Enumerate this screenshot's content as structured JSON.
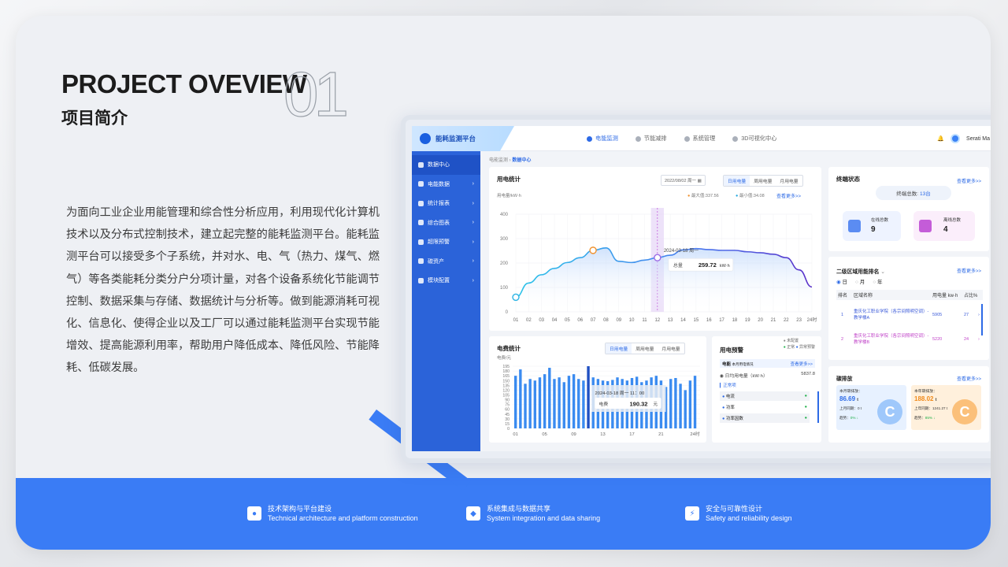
{
  "header": {
    "title_en": "PROJECT OVEVIEW",
    "title_num": "01",
    "title_cn": "项目简介"
  },
  "intro": "为面向工业企业用能管理和综合性分析应用，利用现代化计算机技术以及分布式控制技术，建立起完整的能耗监测平台。能耗监测平台可以接受多个子系统，并对水、电、气（热力、煤气、燃气）等各类能耗分类分户分项计量，对各个设备系统化节能调节控制、数据采集与存储、数据统计与分析等。做到能源消耗可视化、信息化、使得企业以及工厂可以通过能耗监测平台实现节能增效、提高能源利用率，帮助用户降低成本、降低风险、节能降耗、低碳发展。",
  "features": [
    {
      "cn": "技术架构与平台建设",
      "en": "Technical architecture and platform construction",
      "icon": "person-icon"
    },
    {
      "cn": "系统集成与数据共享",
      "en": "System integration and data sharing",
      "icon": "tag-icon"
    },
    {
      "cn": "安全与可靠性设计",
      "en": "Safety and reliability design",
      "icon": "bolt-icon"
    }
  ],
  "app": {
    "name": "能耗监测平台",
    "nav": [
      "电能监测",
      "节能减排",
      "系统管理",
      "3D可视化中心"
    ],
    "user": "Serati Ma",
    "sidebar": [
      "数据中心",
      "电能数据",
      "统计报表",
      "综合图表",
      "超限预警",
      "碳资产",
      "模块配置"
    ],
    "breadcrumb": {
      "parent": "电能监测",
      "current": "数据中心"
    },
    "usage": {
      "title": "用电统计",
      "date": "2022/08/02 周一",
      "tabs": [
        "日用电量",
        "周用电量",
        "月用电量"
      ],
      "unit": "用电量/kW·h",
      "max_label": "最大值:337.56",
      "min_label": "最小值:34.08",
      "more": "查看更多>>",
      "tooltip_time": "2024-03-18 周一",
      "tooltip_label": "总量",
      "tooltip_value": "259.72",
      "tooltip_unit": "kW·h"
    },
    "fee": {
      "title": "电费统计",
      "unit": "电费/元",
      "tabs": [
        "日用电量",
        "周用电量",
        "月用电量"
      ],
      "tooltip_time": "2024-03-18 周一 11：00",
      "tooltip_label": "电费",
      "tooltip_value": "190.32",
      "tooltip_unit": "元"
    },
    "warning": {
      "title": "用电预警",
      "legend": [
        "未配置",
        "正常",
        "异常预警"
      ],
      "sub_label": "电能",
      "sub_desc": "本月用电情况",
      "more": "查看更多>>",
      "daily_label": "日均用电量（kW·h）",
      "daily_value": "5837.8",
      "normal_label": "正常项",
      "items": [
        "电流",
        "功率",
        "功率因数"
      ]
    },
    "terminal": {
      "title": "终端状态",
      "more": "查看更多>>",
      "total_label": "终端总数:",
      "total_value": "13台",
      "online_label": "在线总数",
      "online_value": "9",
      "offline_label": "离线总数",
      "offline_value": "4"
    },
    "ranking": {
      "title": "二级区域用能排名",
      "more": "查看更多>>",
      "periods": [
        "日",
        "月",
        "年"
      ],
      "headers": [
        "排名",
        "区域名称",
        "用电量 kw·h",
        "占比%"
      ],
      "rows": [
        {
          "rank": "1",
          "name": "重庆化工职业学院（各宗间照明空调）-教学楼A",
          "value": "5905",
          "pct": "27"
        },
        {
          "rank": "2",
          "name": "重庆化工职业学院（各宗间照明空调）-教学楼B",
          "value": "5220",
          "pct": "24"
        }
      ]
    },
    "carbon": {
      "title": "碳排放",
      "more": "查看更多>>",
      "month_label": "本月碳排放：",
      "month_value": "86.69",
      "month_unit": "t",
      "month_prev": "上月同期：0 t",
      "month_trend": "趋势：",
      "month_trend_val": "0%",
      "year_label": "本年碳排放：",
      "year_value": "188.02",
      "year_unit": "t",
      "year_prev": "上年同期：1241.27 t",
      "year_trend": "趋势：",
      "year_trend_val": "85%"
    }
  },
  "chart_data": [
    {
      "type": "line",
      "title": "用电统计",
      "ylabel": "用电量/kW·h",
      "x": [
        "01",
        "02",
        "03",
        "04",
        "05",
        "06",
        "07",
        "08",
        "09",
        "10",
        "11",
        "12",
        "13",
        "14",
        "15",
        "16",
        "17",
        "18",
        "19",
        "20",
        "21",
        "22",
        "23",
        "24时"
      ],
      "values": [
        60,
        118,
        152,
        178,
        202,
        222,
        252,
        262,
        207,
        202,
        212,
        222,
        232,
        254,
        259,
        255,
        252,
        252,
        246,
        242,
        236,
        222,
        172,
        102
      ],
      "ylim": [
        0,
        400
      ],
      "yticks": [
        0,
        100,
        200,
        300,
        400
      ]
    },
    {
      "type": "bar",
      "title": "电费统计",
      "ylabel": "电费/元",
      "x": [
        "01",
        "05",
        "09",
        "13",
        "17",
        "21",
        "24时"
      ],
      "values": [
        165,
        185,
        140,
        155,
        150,
        160,
        170,
        190,
        155,
        160,
        145,
        165,
        170,
        155,
        150,
        195,
        160,
        155,
        150,
        148,
        152,
        160,
        155,
        150,
        158,
        162,
        145,
        150,
        160,
        165,
        150,
        130,
        155,
        158,
        140,
        120,
        150,
        165
      ],
      "ylim": [
        0,
        200
      ],
      "yticks": [
        0,
        15,
        30,
        45,
        60,
        75,
        90,
        105,
        120,
        135,
        150,
        165,
        180,
        195
      ]
    }
  ]
}
